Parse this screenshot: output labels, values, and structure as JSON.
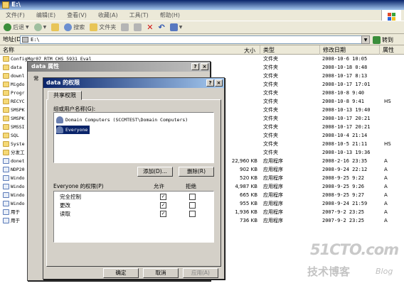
{
  "window": {
    "title": "E:\\"
  },
  "menu": [
    "文件(F)",
    "编辑(E)",
    "查看(V)",
    "收藏(A)",
    "工具(T)",
    "帮助(H)"
  ],
  "toolbar": {
    "back": "后退",
    "search": "搜索",
    "folders": "文件夹"
  },
  "address": {
    "label": "地址(D)",
    "value": "E:\\",
    "go": "转到"
  },
  "columns": [
    "名称",
    "大小",
    "类型",
    "修改日期",
    "属性"
  ],
  "files": [
    {
      "name": "ConfigMgr07 RTM CHS 5931 Eval",
      "size": "",
      "type": "文件夹",
      "date": "2008-10-6 10:05",
      "attr": "",
      "kind": "folder"
    },
    {
      "name": "data",
      "size": "",
      "type": "文件夹",
      "date": "2008-10-18 0:48",
      "attr": "",
      "kind": "folder"
    },
    {
      "name": "downl",
      "size": "",
      "type": "文件夹",
      "date": "2008-10-17 8:13",
      "attr": "",
      "kind": "folder"
    },
    {
      "name": "Migdo",
      "size": "",
      "type": "文件夹",
      "date": "2008-10-17 17:01",
      "attr": "",
      "kind": "folder"
    },
    {
      "name": "Progr",
      "size": "",
      "type": "文件夹",
      "date": "2008-10-8 9:40",
      "attr": "",
      "kind": "folder"
    },
    {
      "name": "RECYC",
      "size": "",
      "type": "文件夹",
      "date": "2008-10-8 9:41",
      "attr": "HS",
      "kind": "folder"
    },
    {
      "name": "SMSPK",
      "size": "",
      "type": "文件夹",
      "date": "2008-10-13 19:40",
      "attr": "",
      "kind": "folder"
    },
    {
      "name": "SMSPK",
      "size": "",
      "type": "文件夹",
      "date": "2008-10-17 20:21",
      "attr": "",
      "kind": "folder"
    },
    {
      "name": "SMSSI",
      "size": "",
      "type": "文件夹",
      "date": "2008-10-17 20:21",
      "attr": "",
      "kind": "folder"
    },
    {
      "name": "SQL",
      "size": "",
      "type": "文件夹",
      "date": "2008-10-4 21:14",
      "attr": "",
      "kind": "folder"
    },
    {
      "name": "Syste",
      "size": "",
      "type": "文件夹",
      "date": "2008-10-5 21:11",
      "attr": "HS",
      "kind": "folder"
    },
    {
      "name": "分发工",
      "size": "",
      "type": "文件夹",
      "date": "2008-10-13 19:36",
      "attr": "",
      "kind": "folder"
    },
    {
      "name": "donet",
      "size": "22,960 KB",
      "type": "应用程序",
      "date": "2008-2-16 23:35",
      "attr": "A",
      "kind": "app"
    },
    {
      "name": "NDP20",
      "size": "902 KB",
      "type": "应用程序",
      "date": "2008-9-24 22:12",
      "attr": "A",
      "kind": "app"
    },
    {
      "name": "Windo",
      "size": "520 KB",
      "type": "应用程序",
      "date": "2008-9-25 9:22",
      "attr": "A",
      "kind": "app"
    },
    {
      "name": "Windo",
      "size": "4,987 KB",
      "type": "应用程序",
      "date": "2008-9-25 9:26",
      "attr": "A",
      "kind": "app"
    },
    {
      "name": "Windo",
      "size": "665 KB",
      "type": "应用程序",
      "date": "2008-9-25 9:27",
      "attr": "A",
      "kind": "app"
    },
    {
      "name": "Windo",
      "size": "955 KB",
      "type": "应用程序",
      "date": "2008-9-24 21:59",
      "attr": "A",
      "kind": "app"
    },
    {
      "name": "用于",
      "size": "1,936 KB",
      "type": "应用程序",
      "date": "2007-9-2 23:25",
      "attr": "A",
      "kind": "app"
    },
    {
      "name": "用于",
      "size": "736 KB",
      "type": "应用程序",
      "date": "2007-9-2 23:25",
      "attr": "A",
      "kind": "app"
    }
  ],
  "props_dialog": {
    "title": "data 属性",
    "tab_partial": "常"
  },
  "perm_dialog": {
    "title": "data 的权限",
    "tab": "共享权限",
    "group_label": "组或用户名称(G):",
    "users": [
      "Domain Computers (SCCMTEST\\Domain Computers)",
      "Everyone"
    ],
    "add_btn": "添加(D)...",
    "remove_btn": "删除(R)",
    "perm_label": "Everyone 的权限(P)",
    "allow": "允许",
    "deny": "拒绝",
    "perms": [
      {
        "name": "完全控制",
        "allow": true,
        "deny": false
      },
      {
        "name": "更改",
        "allow": true,
        "deny": false
      },
      {
        "name": "读取",
        "allow": true,
        "deny": false
      }
    ],
    "ok": "确定",
    "cancel": "取消",
    "apply": "应用(A)"
  },
  "watermark": {
    "line1": "51CTO.com",
    "line2": "技术博客",
    "line3": "Blog"
  }
}
